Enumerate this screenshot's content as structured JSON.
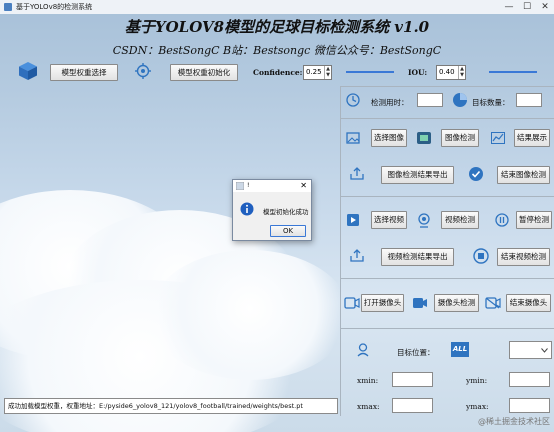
{
  "window": {
    "title": "基于YOLOv8的检测系统",
    "min": "—",
    "max": "☐",
    "close": "✕"
  },
  "header": {
    "title": "基于YOLOV8模型的足球目标检测系统 v1.0",
    "subtitle": "CSDN：BestSongC   B站：Bestsongc   微信公众号：BestSongC"
  },
  "toolbar": {
    "select_model": "模型权重选择",
    "init_model": "模型权重初始化",
    "confidence_label": "Confidence:",
    "confidence_value": "0.25",
    "iou_label": "IOU:",
    "iou_value": "0.40",
    "confidence_slider_level": 0.25,
    "iou_slider_level": 0.4
  },
  "stats": {
    "time_label": "检测用时：",
    "count_label": "目标数量："
  },
  "image": {
    "select": "选择图像",
    "detect": "图像检测",
    "show": "结果展示",
    "export": "图像检测结果导出",
    "stop": "结束图像检测"
  },
  "video": {
    "select": "选择视频",
    "detect": "视频检测",
    "pause": "暂停检测",
    "export": "视频检测结果导出",
    "stop": "结束视频检测"
  },
  "camera": {
    "open": "打开摄像头",
    "detect": "摄像头检测",
    "stop": "结束摄像头"
  },
  "target": {
    "position_label": "目标位置：",
    "all_badge": "ALL",
    "xmin": "xmin:",
    "ymin": "ymin:",
    "xmax": "xmax:",
    "ymax": "ymax:"
  },
  "status": {
    "text": "成功加载模型权重，权重地址：E:/pyside6_yolov8_121/yolov8_football/trained/weights/best.pt"
  },
  "dialog": {
    "title": "!",
    "message": "模型初始化成功",
    "ok": "OK"
  },
  "watermark": "@稀土掘金技术社区",
  "colors": {
    "accent": "#3a78d6",
    "icon_blue": "#2f74c0"
  }
}
